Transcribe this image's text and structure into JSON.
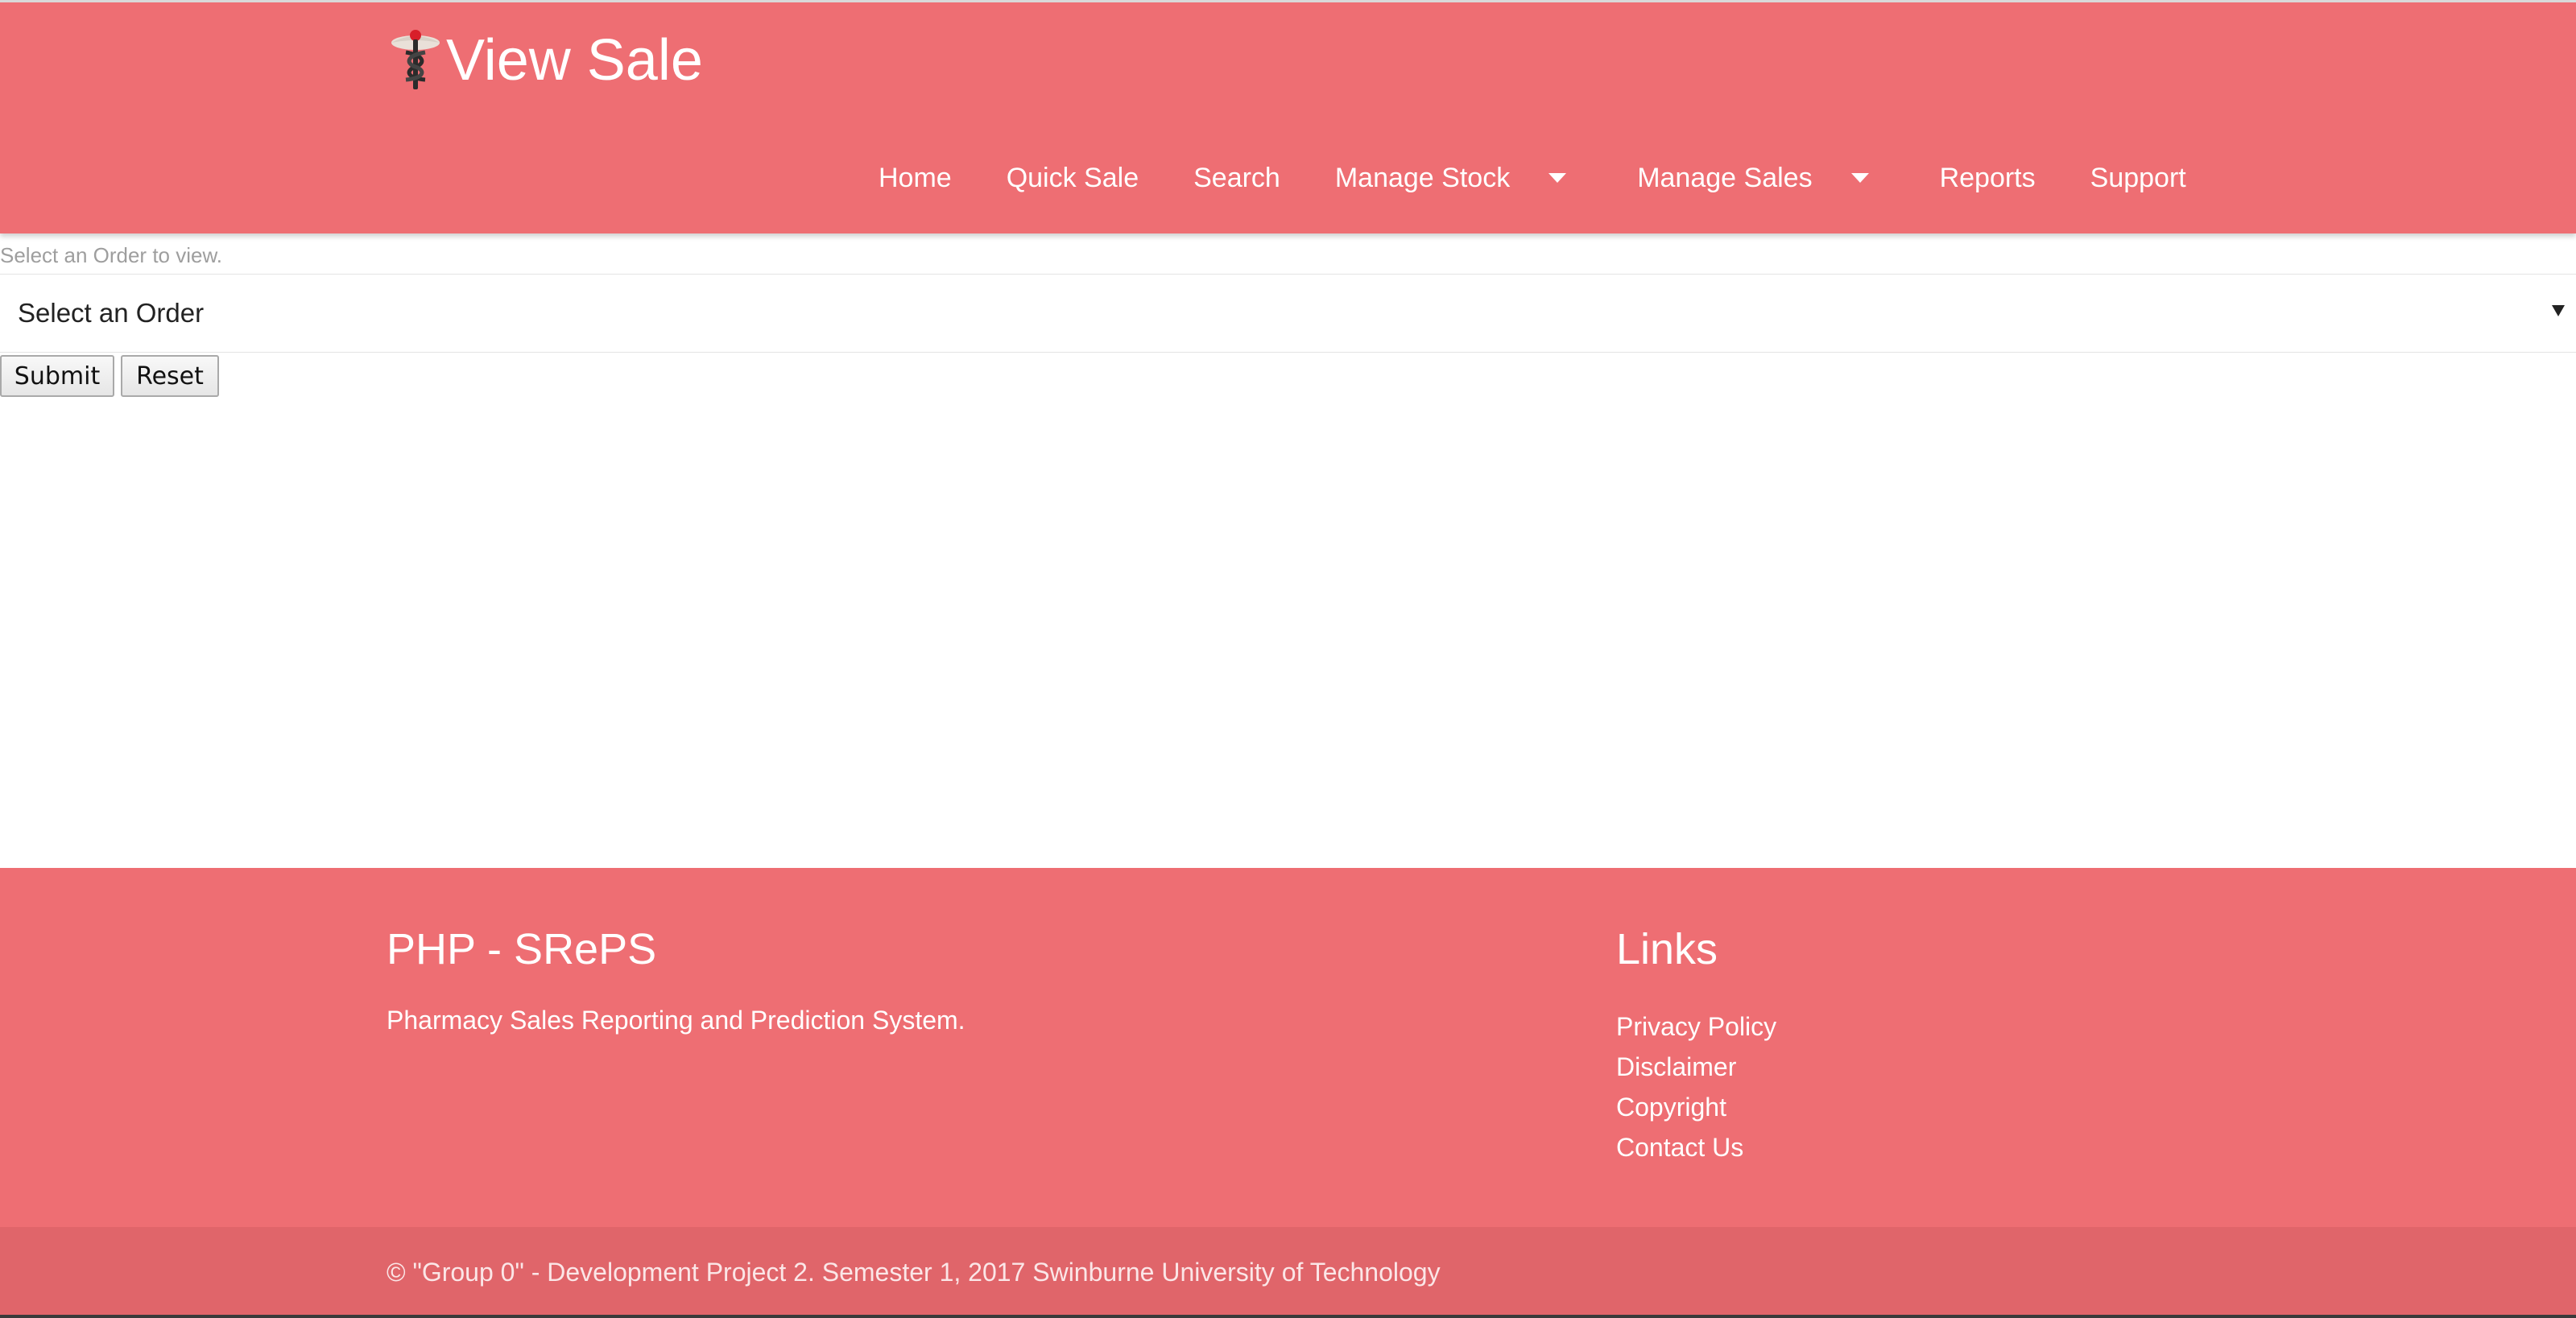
{
  "header": {
    "title": "View Sale",
    "logo_icon": "caduceus-icon",
    "background": "#ee6e73"
  },
  "nav": {
    "items": [
      {
        "label": "Home"
      },
      {
        "label": "Quick Sale"
      },
      {
        "label": "Search"
      },
      {
        "label": "Manage Stock",
        "dropdown": true
      },
      {
        "label": "Manage Sales",
        "dropdown": true
      },
      {
        "label": "Reports"
      },
      {
        "label": "Support"
      }
    ]
  },
  "form": {
    "hint": "Select an Order to view.",
    "select_value": "Select an Order",
    "submit_label": "Submit",
    "reset_label": "Reset"
  },
  "footer": {
    "brand_title": "PHP - SRePS",
    "brand_text": "Pharmacy Sales Reporting and Prediction System.",
    "links_title": "Links",
    "links": [
      "Privacy Policy",
      "Disclaimer",
      "Copyright",
      "Contact Us"
    ],
    "copyright": "© \"Group 0\" - Development Project 2. Semester 1, 2017 Swinburne University of Technology"
  }
}
